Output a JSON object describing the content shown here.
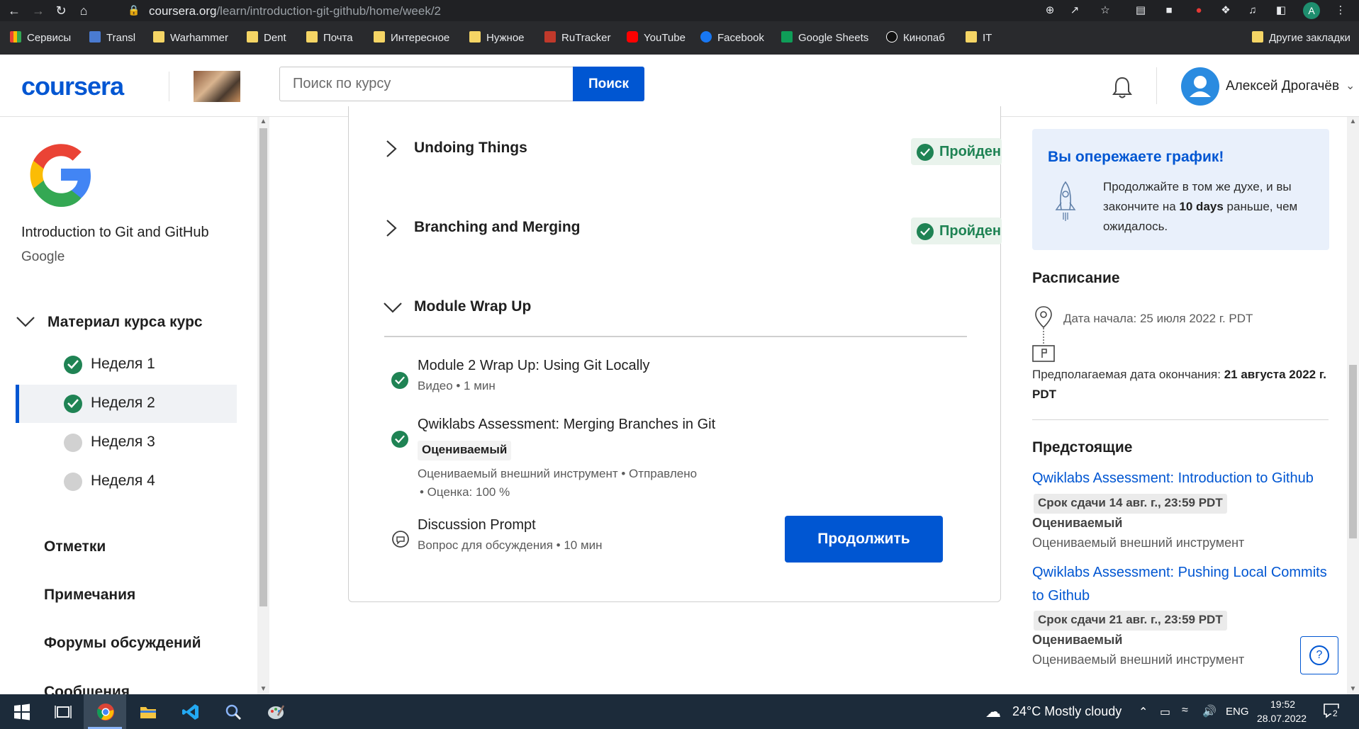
{
  "browser": {
    "url_host": "coursera.org",
    "url_path": "/learn/introduction-git-github/home/week/2",
    "profile_initial": "A"
  },
  "bookmarks": [
    {
      "label": "Сервисы"
    },
    {
      "label": "Transl"
    },
    {
      "label": "Warhammer"
    },
    {
      "label": "Dent"
    },
    {
      "label": "Почта"
    },
    {
      "label": "Интересное"
    },
    {
      "label": "Нужное"
    },
    {
      "label": "RuTracker"
    },
    {
      "label": "YouTube"
    },
    {
      "label": "Facebook"
    },
    {
      "label": "Google Sheets"
    },
    {
      "label": "Кинопаб"
    },
    {
      "label": "IT"
    },
    {
      "label": "Другие закладки"
    }
  ],
  "header": {
    "logo": "coursera",
    "search_placeholder": "Поиск по курсу",
    "search_button": "Поиск",
    "user_name": "Алексей Дрогачёв"
  },
  "sidebar": {
    "course_title": "Introduction to Git and GitHub",
    "course_org": "Google",
    "material_label": "Материал курса курс",
    "weeks": [
      {
        "label": "Неделя 1",
        "status": "done"
      },
      {
        "label": "Неделя 2",
        "status": "done",
        "active": true
      },
      {
        "label": "Неделя 3",
        "status": "todo"
      },
      {
        "label": "Неделя 4",
        "status": "todo"
      }
    ],
    "links": [
      "Отметки",
      "Примечания",
      "Форумы обсуждений",
      "Сообщения"
    ]
  },
  "main": {
    "lessons": [
      {
        "title": "Undoing Things",
        "status": "Пройден"
      },
      {
        "title": "Branching and Merging",
        "status": "Пройден"
      },
      {
        "title": "Module Wrap Up"
      }
    ],
    "items": [
      {
        "title": "Module 2 Wrap Up: Using Git Locally",
        "meta": "Видео • 1 мин"
      },
      {
        "title": "Qwiklabs Assessment: Merging Branches in Git",
        "chip": "Оцениваемый",
        "meta1": "Оцениваемый внешний инструмент • Отправлено",
        "meta2": "• Оценка: 100 %"
      },
      {
        "title": "Discussion Prompt",
        "meta": "Вопрос для обсуждения • 10 мин"
      }
    ],
    "continue_button": "Продолжить"
  },
  "right": {
    "ahead_title": "Вы опережаете график!",
    "ahead_text_1": "Продолжайте в том же духе, и вы закончите на ",
    "ahead_bold": "10 days",
    "ahead_text_2": " раньше, чем ожидалось.",
    "schedule_heading": "Расписание",
    "start_date": "Дата начала: 25 июля 2022 г. PDT",
    "end_label": "Предполагаемая дата окончания: ",
    "end_value": "21 августа 2022 г. PDT",
    "upcoming_heading": "Предстоящие",
    "upcoming": [
      {
        "title": "Qwiklabs Assessment: Introduction to Github",
        "due": "Срок сдачи 14 авг. г., 23:59 PDT",
        "graded": "Оцениваемый",
        "type": "Оцениваемый внешний инструмент"
      },
      {
        "title": "Qwiklabs Assessment: Pushing Local Commits to Github",
        "due": "Срок сдачи 21 авг. г., 23:59 PDT",
        "graded": "Оцениваемый",
        "type": "Оцениваемый внешний инструмент"
      }
    ]
  },
  "taskbar": {
    "weather": "24°C  Mostly cloudy",
    "lang": "ENG",
    "time": "19:52",
    "date": "28.07.2022",
    "notifications": "2"
  }
}
